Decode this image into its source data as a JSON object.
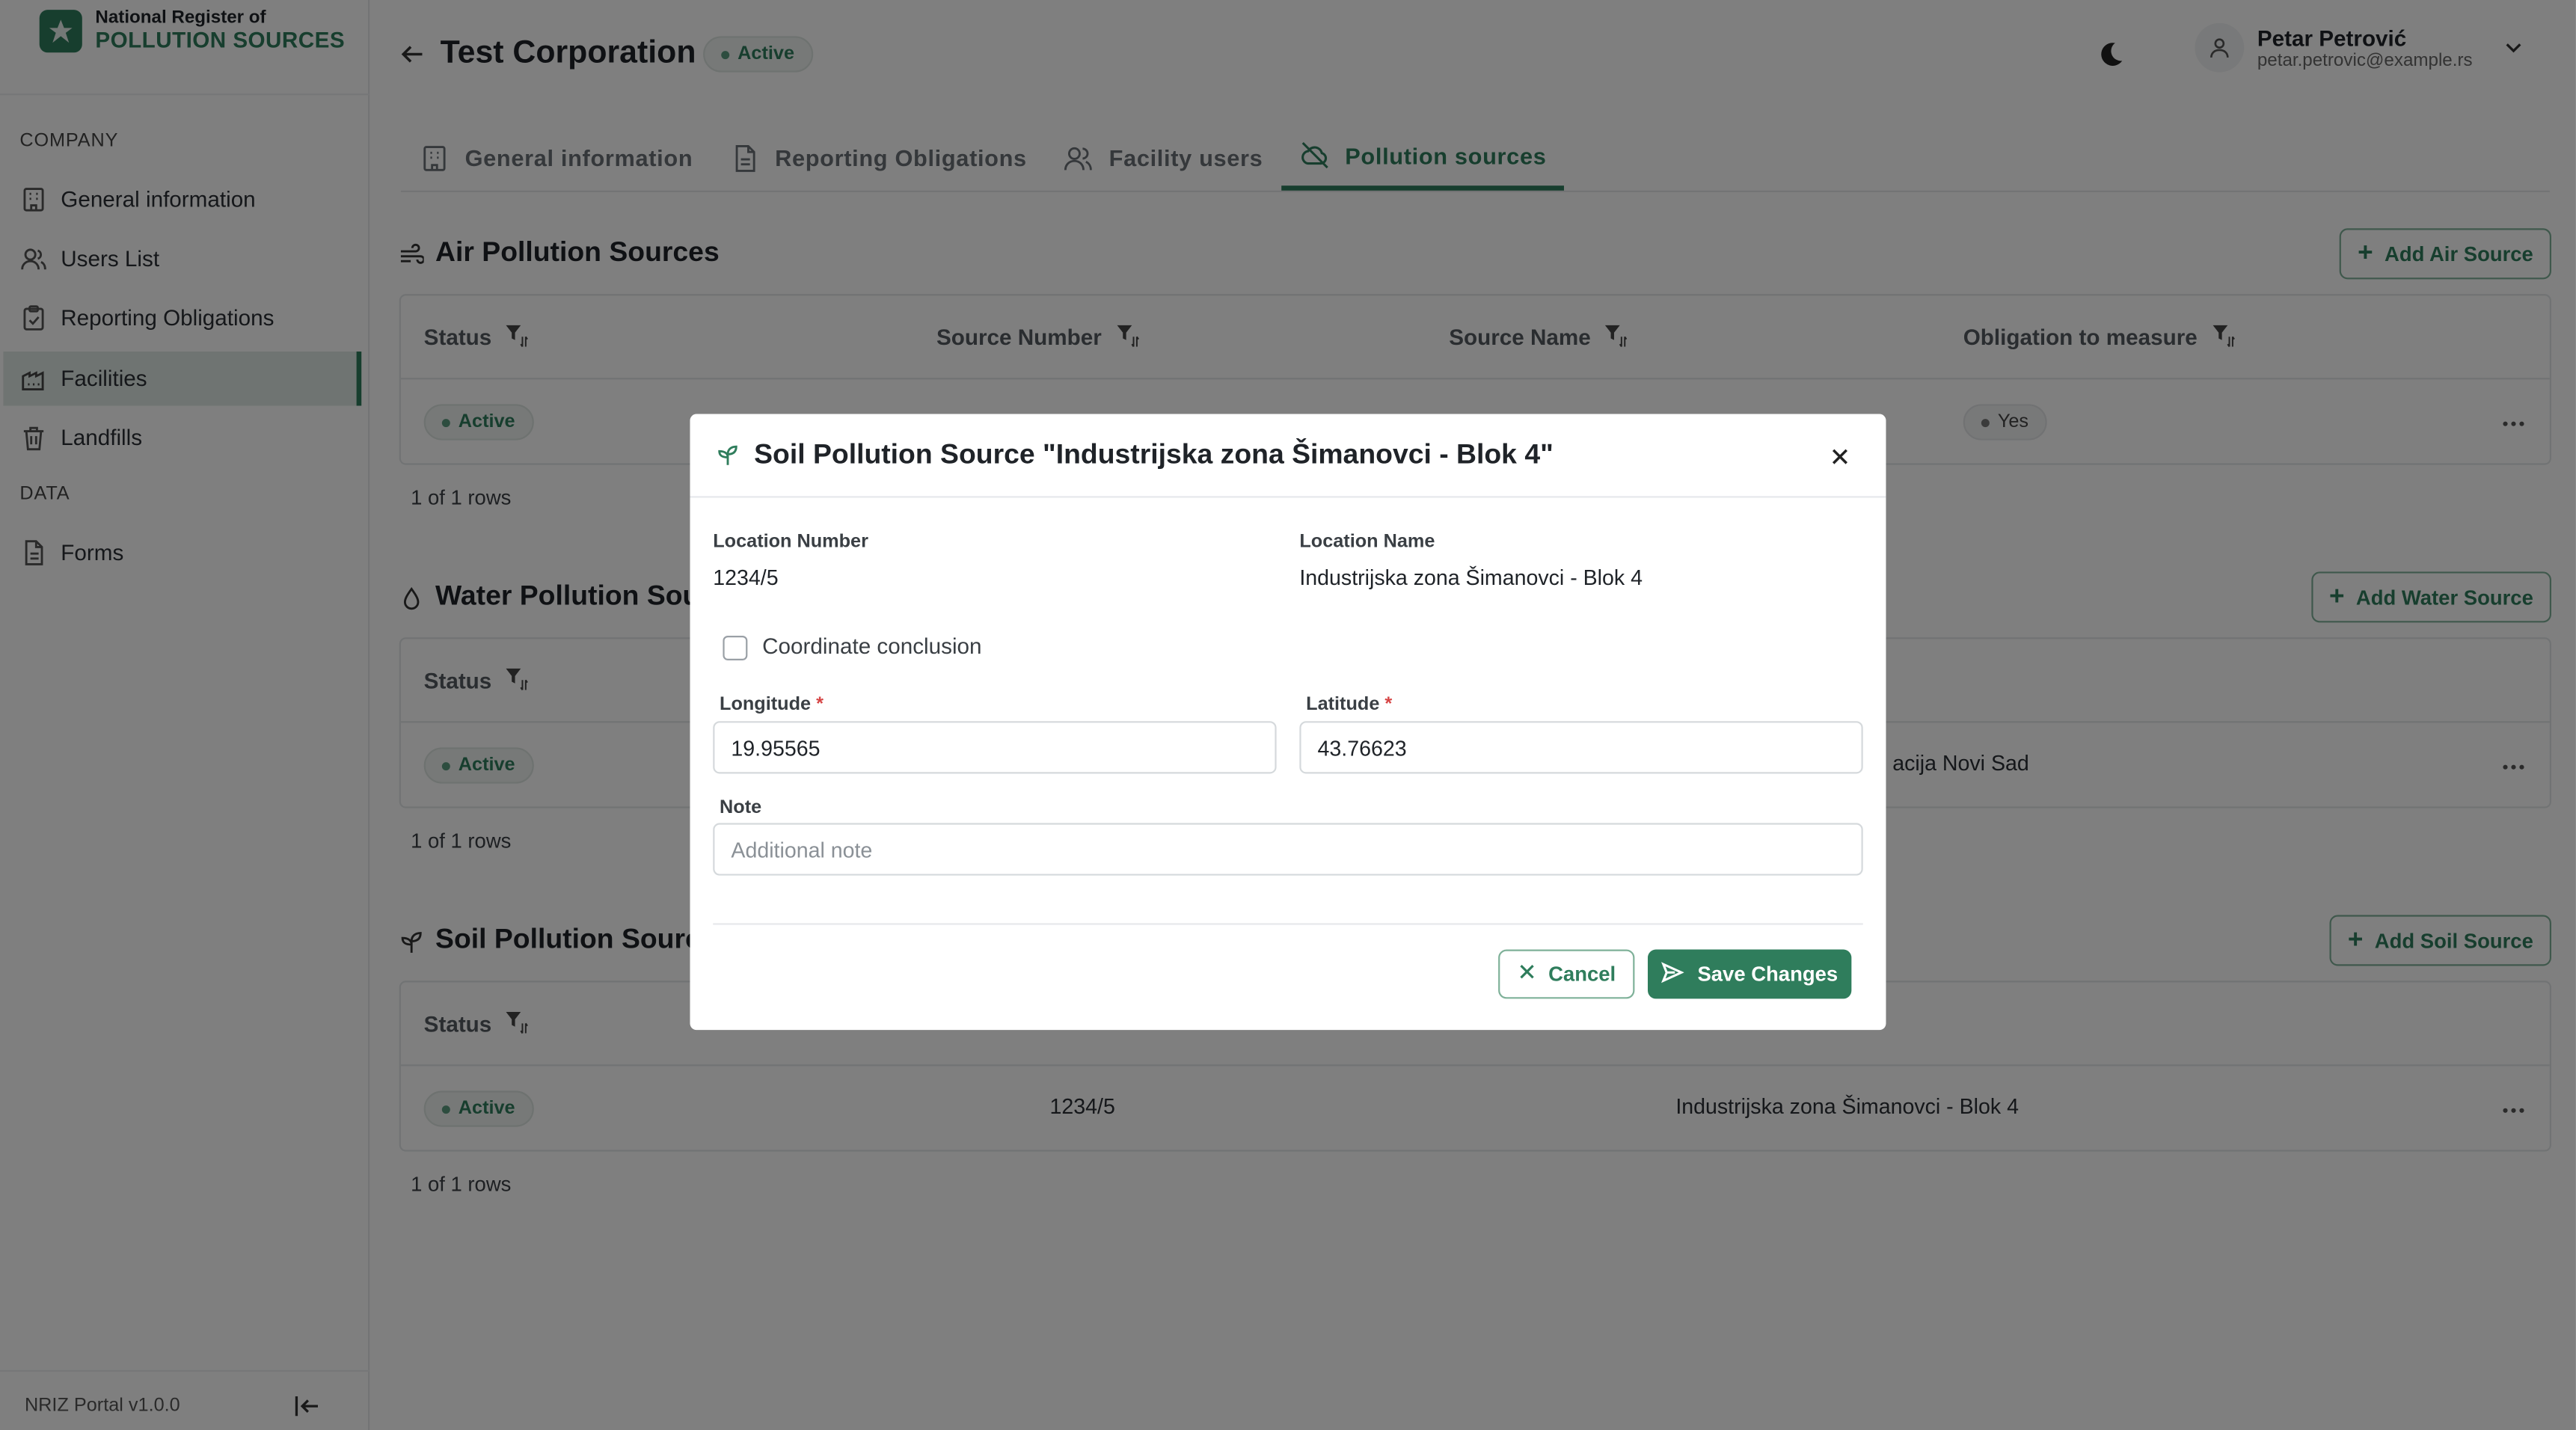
{
  "brand": {
    "line1": "National Register of",
    "line2": "POLLUTION SOURCES"
  },
  "sidebar": {
    "company_label": "COMPANY",
    "data_label": "DATA",
    "items": [
      {
        "label": "General information",
        "icon": "building-icon"
      },
      {
        "label": "Users List",
        "icon": "users-icon"
      },
      {
        "label": "Reporting Obligations",
        "icon": "clipboard-icon"
      },
      {
        "label": "Facilities",
        "icon": "factory-icon",
        "active": true
      },
      {
        "label": "Landfills",
        "icon": "trash-icon"
      }
    ],
    "data_items": [
      {
        "label": "Forms",
        "icon": "document-icon"
      }
    ],
    "version": "NRIZ Portal v1.0.0"
  },
  "header": {
    "title": "Test Corporation",
    "status": "Active",
    "user_name": "Petar Petrović",
    "user_email": "petar.petrovic@example.rs"
  },
  "tabs": [
    {
      "label": "General information",
      "icon": "building-icon"
    },
    {
      "label": "Reporting Obligations",
      "icon": "document-icon"
    },
    {
      "label": "Facility users",
      "icon": "users-icon"
    },
    {
      "label": "Pollution sources",
      "icon": "no-cloud-icon",
      "active": true
    }
  ],
  "air": {
    "title": "Air Pollution Sources",
    "add_label": "Add Air Source",
    "columns": [
      "Status",
      "Source Number",
      "Source Name",
      "Obligation to measure"
    ],
    "row": {
      "status": "Active",
      "obligation": "Yes"
    },
    "count": "1 of 1 rows"
  },
  "water": {
    "title": "Water Pollution Sou",
    "add_label": "Add Water Source",
    "columns": [
      "Status"
    ],
    "row": {
      "status": "Active",
      "name_fragment": "acija Novi Sad"
    },
    "count": "1 of 1 rows"
  },
  "soil": {
    "title": "Soil Pollution Sourc",
    "add_label": "Add Soil Source",
    "columns": [
      "Status"
    ],
    "row": {
      "status": "Active",
      "number": "1234/5",
      "name": "Industrijska zona Šimanovci - Blok 4"
    },
    "count": "1 of 1 rows"
  },
  "modal": {
    "title": "Soil Pollution Source \"Industrijska zona Šimanovci - Blok 4\"",
    "location_number_label": "Location Number",
    "location_number": "1234/5",
    "location_name_label": "Location Name",
    "location_name": "Industrijska zona Šimanovci - Blok 4",
    "checkbox_label": "Coordinate conclusion",
    "longitude_label": "Longitude",
    "longitude": "19.95565",
    "latitude_label": "Latitude",
    "latitude": "43.76623",
    "required_mark": "*",
    "note_label": "Note",
    "note_placeholder": "Additional note",
    "cancel_label": "Cancel",
    "save_label": "Save Changes"
  },
  "colors": {
    "accent": "#2f7d5c",
    "overlay": "rgba(0,0,0,0.5)",
    "required": "#d64545"
  }
}
